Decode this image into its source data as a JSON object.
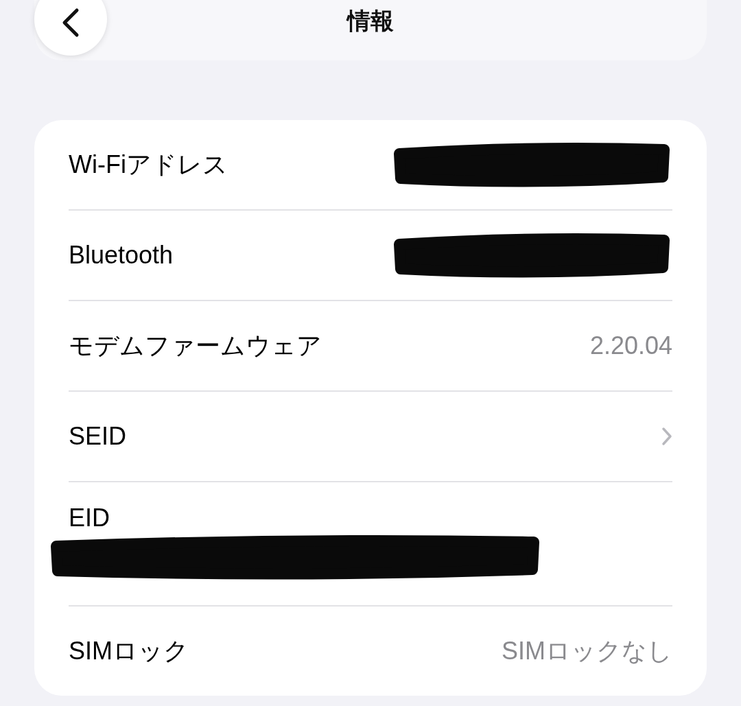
{
  "nav": {
    "title": "情報"
  },
  "rows": [
    {
      "kind": "redacted",
      "label": "Wi-Fiアドレス"
    },
    {
      "kind": "redacted",
      "label": "Bluetooth"
    },
    {
      "kind": "value",
      "label": "モデムファームウェア",
      "value": "2.20.04"
    },
    {
      "kind": "link",
      "label": "SEID"
    },
    {
      "kind": "stacked-redacted",
      "label": "EID"
    },
    {
      "kind": "value",
      "label": "SIMロック",
      "value": "SIMロックなし"
    }
  ]
}
